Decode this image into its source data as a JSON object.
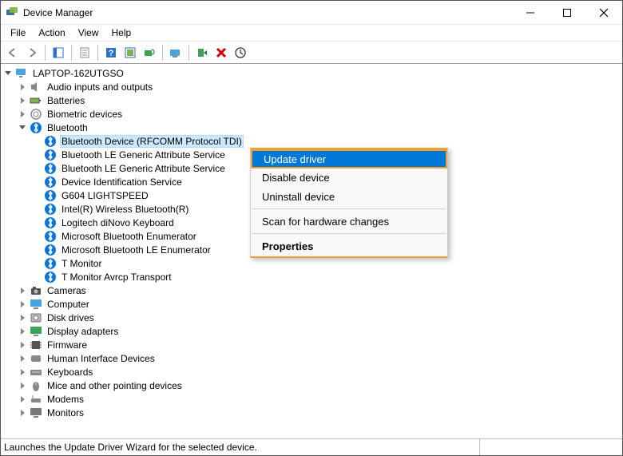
{
  "window": {
    "title": "Device Manager"
  },
  "menubar": [
    "File",
    "Action",
    "View",
    "Help"
  ],
  "toolbar_icons": [
    "back",
    "forward",
    "sep",
    "show-hide",
    "sep",
    "properties",
    "sep",
    "help",
    "refresh",
    "uninstall",
    "sep",
    "computer",
    "sep",
    "add-legacy",
    "delete",
    "update"
  ],
  "tree": {
    "root": "LAPTOP-162UTGSO",
    "categories": [
      {
        "label": "Audio inputs and outputs",
        "expanded": false,
        "icon": "speaker"
      },
      {
        "label": "Batteries",
        "expanded": false,
        "icon": "battery"
      },
      {
        "label": "Biometric devices",
        "expanded": false,
        "icon": "biometric"
      },
      {
        "label": "Bluetooth",
        "expanded": true,
        "icon": "bluetooth",
        "children": [
          {
            "label": "Bluetooth Device (RFCOMM Protocol TDI)",
            "icon": "bluetooth",
            "selected": true
          },
          {
            "label": "Bluetooth LE Generic Attribute Service",
            "icon": "bluetooth"
          },
          {
            "label": "Bluetooth LE Generic Attribute Service",
            "icon": "bluetooth"
          },
          {
            "label": "Device Identification Service",
            "icon": "bluetooth"
          },
          {
            "label": "G604 LIGHTSPEED",
            "icon": "bluetooth"
          },
          {
            "label": "Intel(R) Wireless Bluetooth(R)",
            "icon": "bluetooth"
          },
          {
            "label": "Logitech diNovo Keyboard",
            "icon": "bluetooth"
          },
          {
            "label": "Microsoft Bluetooth Enumerator",
            "icon": "bluetooth"
          },
          {
            "label": "Microsoft Bluetooth LE Enumerator",
            "icon": "bluetooth"
          },
          {
            "label": "T Monitor",
            "icon": "bluetooth"
          },
          {
            "label": "T Monitor Avrcp Transport",
            "icon": "bluetooth"
          }
        ]
      },
      {
        "label": "Cameras",
        "expanded": false,
        "icon": "camera"
      },
      {
        "label": "Computer",
        "expanded": false,
        "icon": "monitor"
      },
      {
        "label": "Disk drives",
        "expanded": false,
        "icon": "disk"
      },
      {
        "label": "Display adapters",
        "expanded": false,
        "icon": "display"
      },
      {
        "label": "Firmware",
        "expanded": false,
        "icon": "chip"
      },
      {
        "label": "Human Interface Devices",
        "expanded": false,
        "icon": "hid"
      },
      {
        "label": "Keyboards",
        "expanded": false,
        "icon": "keyboard"
      },
      {
        "label": "Mice and other pointing devices",
        "expanded": false,
        "icon": "mouse"
      },
      {
        "label": "Modems",
        "expanded": false,
        "icon": "modem"
      },
      {
        "label": "Monitors",
        "expanded": false,
        "icon": "monitor2"
      }
    ]
  },
  "context_menu": {
    "items": [
      {
        "label": "Update driver",
        "highlight": true
      },
      {
        "label": "Disable device"
      },
      {
        "label": "Uninstall device"
      },
      {
        "sep": true
      },
      {
        "label": "Scan for hardware changes"
      },
      {
        "sep": true
      },
      {
        "label": "Properties",
        "bold": true
      }
    ]
  },
  "statusbar": "Launches the Update Driver Wizard for the selected device."
}
